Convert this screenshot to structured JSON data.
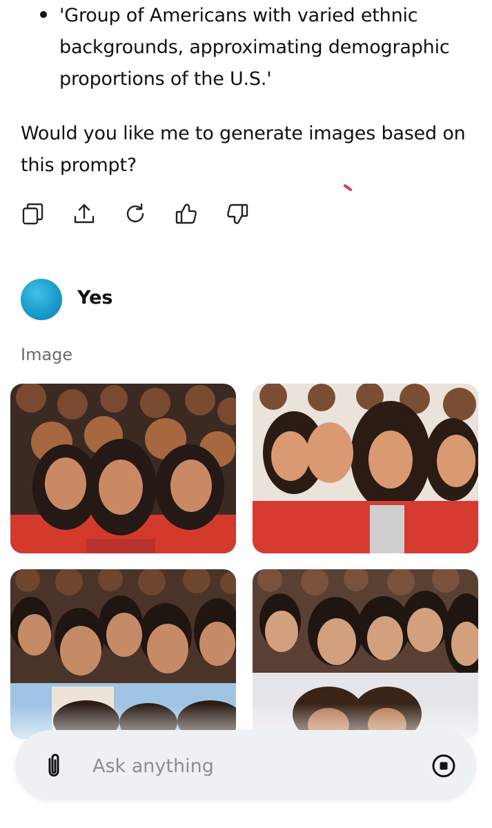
{
  "conversation": {
    "bullet_text": "'Group of Americans with varied ethnic backgrounds, approximating demographic proportions of the U.S.'",
    "assistant_question": "Would you like me to generate images based on this prompt?",
    "actions": [
      {
        "name": "copy-icon"
      },
      {
        "name": "share-icon"
      },
      {
        "name": "regenerate-icon"
      },
      {
        "name": "thumbs-up-icon"
      },
      {
        "name": "thumbs-down-icon"
      }
    ],
    "user_message": "Yes",
    "section_label": "Image"
  },
  "images": [
    {
      "label": "generated-image-1",
      "palette": [
        "#a8562f",
        "#6a3a22",
        "#c98a63",
        "#d43a2c"
      ]
    },
    {
      "label": "generated-image-2",
      "palette": [
        "#b8744a",
        "#5a3a28",
        "#d99a72",
        "#d63a30"
      ]
    },
    {
      "label": "generated-image-3",
      "palette": [
        "#8a5436",
        "#4a2e20",
        "#c48b66",
        "#9ec3e3"
      ]
    },
    {
      "label": "generated-image-4",
      "palette": [
        "#9a6040",
        "#4a2e20",
        "#d2a07c",
        "#e6e6ea"
      ]
    }
  ],
  "composer": {
    "placeholder": "Ask anything",
    "value": ""
  },
  "colors": {
    "accent_mark": "#e33b3b",
    "avatar": "#1a9ccc",
    "composer_bg": "#eef1f4"
  }
}
